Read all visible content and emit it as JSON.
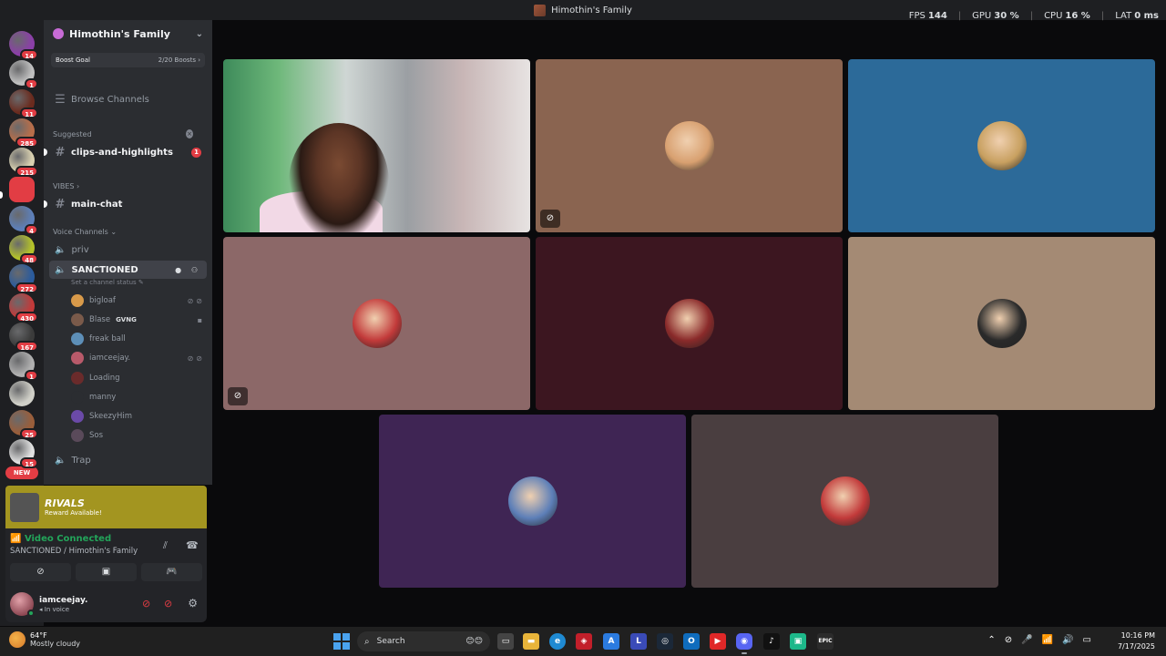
{
  "window": {
    "title": "Himothin's Family",
    "perf": [
      {
        "label": "FPS",
        "value": "144"
      },
      {
        "label": "GPU",
        "value": "30 %"
      },
      {
        "label": "CPU",
        "value": "16 %"
      },
      {
        "label": "LAT",
        "value": "0 ms"
      }
    ]
  },
  "servers": [
    {
      "badge": "14",
      "color": "#8b3fa8"
    },
    {
      "badge": "1",
      "color": "#c0c0c0"
    },
    {
      "badge": "11",
      "color": "#6a2b1e"
    },
    {
      "badge": "285",
      "color": "#b86e4a"
    },
    {
      "badge": "215",
      "color": "#d8d0b0"
    },
    {
      "badge": "",
      "color": "#e23d44"
    },
    {
      "badge": "4",
      "color": "#5d7fb8"
    },
    {
      "badge": "48",
      "color": "#b4c22a"
    },
    {
      "badge": "272",
      "color": "#2b5b9c"
    },
    {
      "badge": "430",
      "color": "#c23a3a"
    },
    {
      "badge": "167",
      "color": "#3b3b3b"
    },
    {
      "badge": "1",
      "color": "#b0b0b0"
    },
    {
      "badge": "",
      "color": "#d0d0c8"
    },
    {
      "badge": "25",
      "color": "#9a5e3a"
    },
    {
      "badge": "15",
      "color": "#e0e0e0"
    }
  ],
  "new_label": "NEW",
  "sidebar": {
    "server_name": "Himothin's Family",
    "boost_goal": "Boost Goal",
    "boost_count": "2/20 Boosts",
    "browse": "Browse Channels",
    "suggested_label": "Suggested",
    "suggested_channel": "clips-and-highlights",
    "suggested_badge": "1",
    "vibes_label": "VIBES",
    "main_chat": "main-chat",
    "voice_label": "Voice Channels",
    "priv": "priv",
    "sanctioned": "SANCTIONED",
    "status_hint": "Set a channel status",
    "trap": "Trap",
    "members": [
      {
        "name": "bigloaf",
        "icons": "⊘⊘",
        "color": "#d89a4a"
      },
      {
        "name": "Blase",
        "icons": "▪",
        "tag": "GVNG",
        "color": "#7a5a4a"
      },
      {
        "name": "freak ball",
        "icons": "",
        "color": "#5d8fb8"
      },
      {
        "name": "iamceejay.",
        "icons": "⊘⊘",
        "color": "#b85a6a"
      },
      {
        "name": "Loading",
        "icons": "",
        "color": "#6a2b2b"
      },
      {
        "name": "manny",
        "icons": "",
        "color": "#2b2d31"
      },
      {
        "name": "SkeezyHim",
        "icons": "",
        "color": "#6b4aa8"
      },
      {
        "name": "Sos",
        "icons": "",
        "color": "#5a4a5a"
      }
    ]
  },
  "rivals": {
    "logo": "RIVALS",
    "sub": "Reward Available!"
  },
  "voice_panel": {
    "status": "Video Connected",
    "location": "SANCTIONED / Himothin's Family"
  },
  "user": {
    "name": "iamceejay.",
    "status": "In voice"
  },
  "tiles": [
    {
      "bg": "#8a6450",
      "av": "#d8a070",
      "muted": true
    },
    {
      "bg": "#2c6a99",
      "av": "#c8a060",
      "muted": false
    },
    {
      "bg": "#8c6868",
      "av": "#c23a3a",
      "muted": true
    },
    {
      "bg": "#3c1620",
      "av": "#8a2a2a",
      "muted": false
    },
    {
      "bg": "#a48a74",
      "av": "#2a2a2a",
      "muted": false
    },
    {
      "bg": "#3f2554",
      "av": "#5d7fb8",
      "muted": false
    },
    {
      "bg": "#4a3e40",
      "av": "#c23a3a",
      "muted": false
    }
  ],
  "taskbar": {
    "temp": "64°F",
    "weather": "Mostly cloudy",
    "search": "Search",
    "time": "10:16 PM",
    "date": "7/17/2025"
  }
}
